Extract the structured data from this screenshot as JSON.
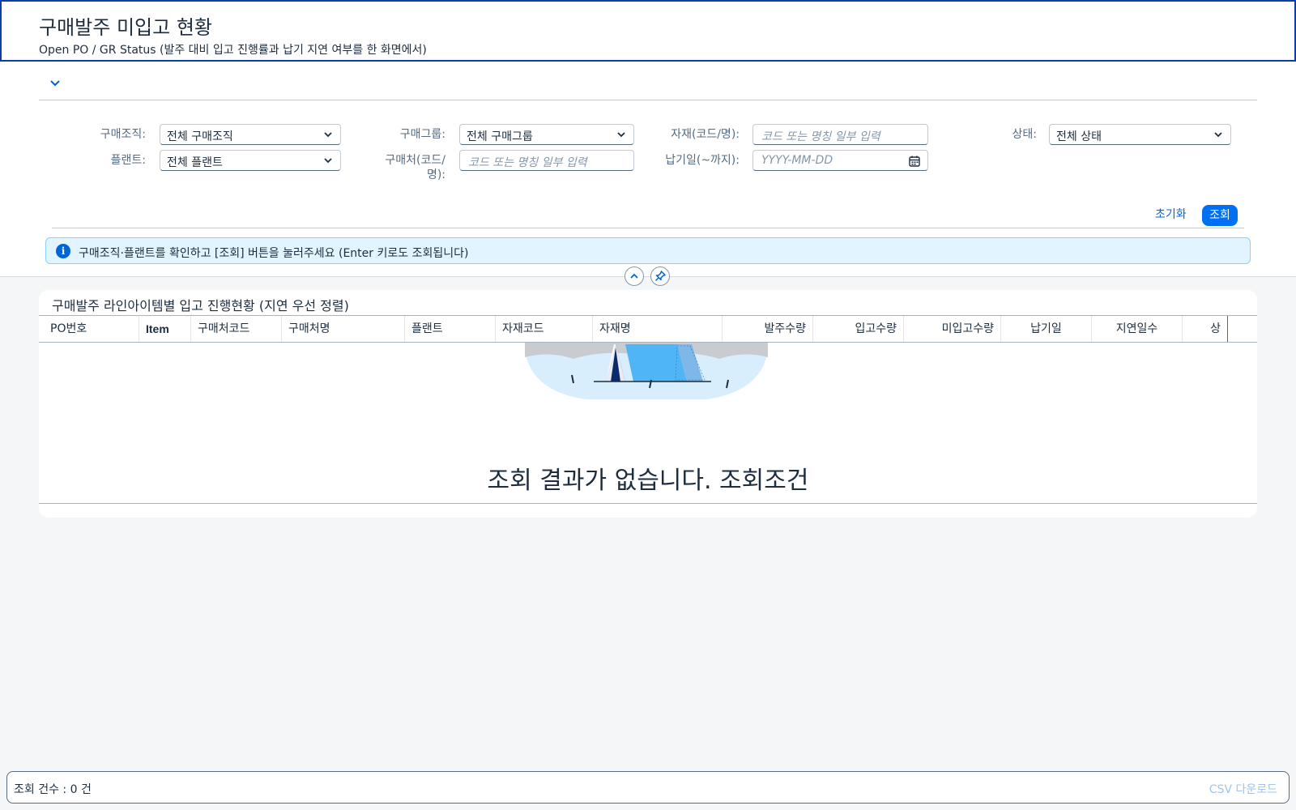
{
  "header": {
    "title": "구매발주 미입고 현황",
    "subtitle": "Open PO / GR Status (발주 대비 입고 진행률과 납기 지연 여부를 한 화면에서)"
  },
  "filters": {
    "purch_org": {
      "label": "구매조직:",
      "value": "전체 구매조직"
    },
    "plant": {
      "label": "플랜트:",
      "value": "전체 플랜트"
    },
    "purch_group": {
      "label": "구매그룹:",
      "value": "전체 구매그룹"
    },
    "vendor": {
      "label_line1": "구매처(코드/",
      "label_line2": "명):",
      "placeholder": "코드 또는 명칭 일부 입력"
    },
    "material": {
      "label": "자재(코드/명):",
      "placeholder": "코드 또는 명칭 일부 입력"
    },
    "delivery_date": {
      "label": "납기일(~까지):",
      "placeholder": "YYYY-MM-DD"
    },
    "status": {
      "label": "상태:",
      "value": "전체 상태"
    }
  },
  "actions": {
    "reset_label": "초기화",
    "search_label": "조회"
  },
  "message": {
    "text": "구매조직·플랜트를 확인하고 [조회] 버튼을 눌러주세요 (Enter 키로도 조회됩니다)",
    "icon": "info-icon"
  },
  "table": {
    "title": "구매발주 라인아이템별 입고 진행현황 (지연 우선 정렬)",
    "columns": [
      "PO번호",
      "Item",
      "구매처코드",
      "구매처명",
      "플랜트",
      "자재코드",
      "자재명",
      "발주수량",
      "입고수량",
      "미입고수량",
      "납기일",
      "지연일수",
      "상"
    ],
    "no_data_text": "조회 결과가 없습니다. 조회조건"
  },
  "footer": {
    "count_text": "조회 건수 : 0 건",
    "csv_label": "CSV 다운로드"
  },
  "colors": {
    "accent": "#0070f2",
    "header_border": "#0a3ea8",
    "info_bg": "#e1f4ff"
  }
}
